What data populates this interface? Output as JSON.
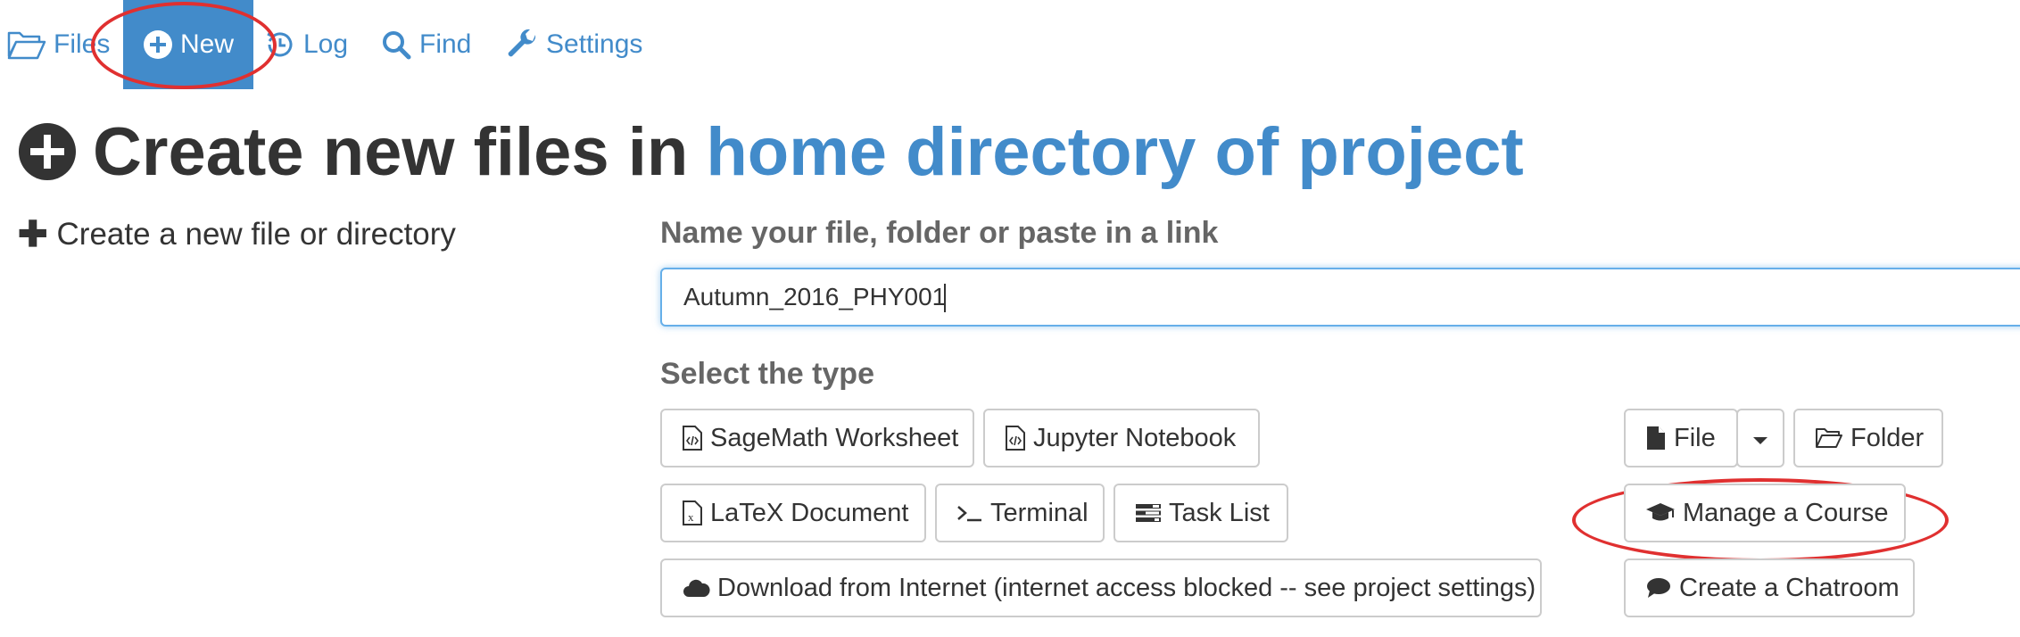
{
  "nav": {
    "files_label": "Files",
    "new_label": "New",
    "log_label": "Log",
    "find_label": "Find",
    "settings_label": "Settings"
  },
  "header": {
    "title_prefix": "Create new files in",
    "title_link": "home directory of project"
  },
  "left": {
    "create_label": "Create a new file or directory"
  },
  "form": {
    "name_label": "Name your file, folder or paste in a link",
    "name_value": "Autumn_2016_PHY001",
    "type_label": "Select the type"
  },
  "types": {
    "sagemath": "SageMath Worksheet",
    "jupyter": "Jupyter Notebook",
    "latex": "LaTeX Document",
    "terminal": "Terminal",
    "tasklist": "Task List",
    "download": "Download from Internet (internet access blocked -- see project settings)",
    "file": "File",
    "folder": "Folder",
    "course": "Manage a Course",
    "chatroom": "Create a Chatroom"
  },
  "colors": {
    "accent": "#428bca",
    "annotation": "#e03030"
  }
}
